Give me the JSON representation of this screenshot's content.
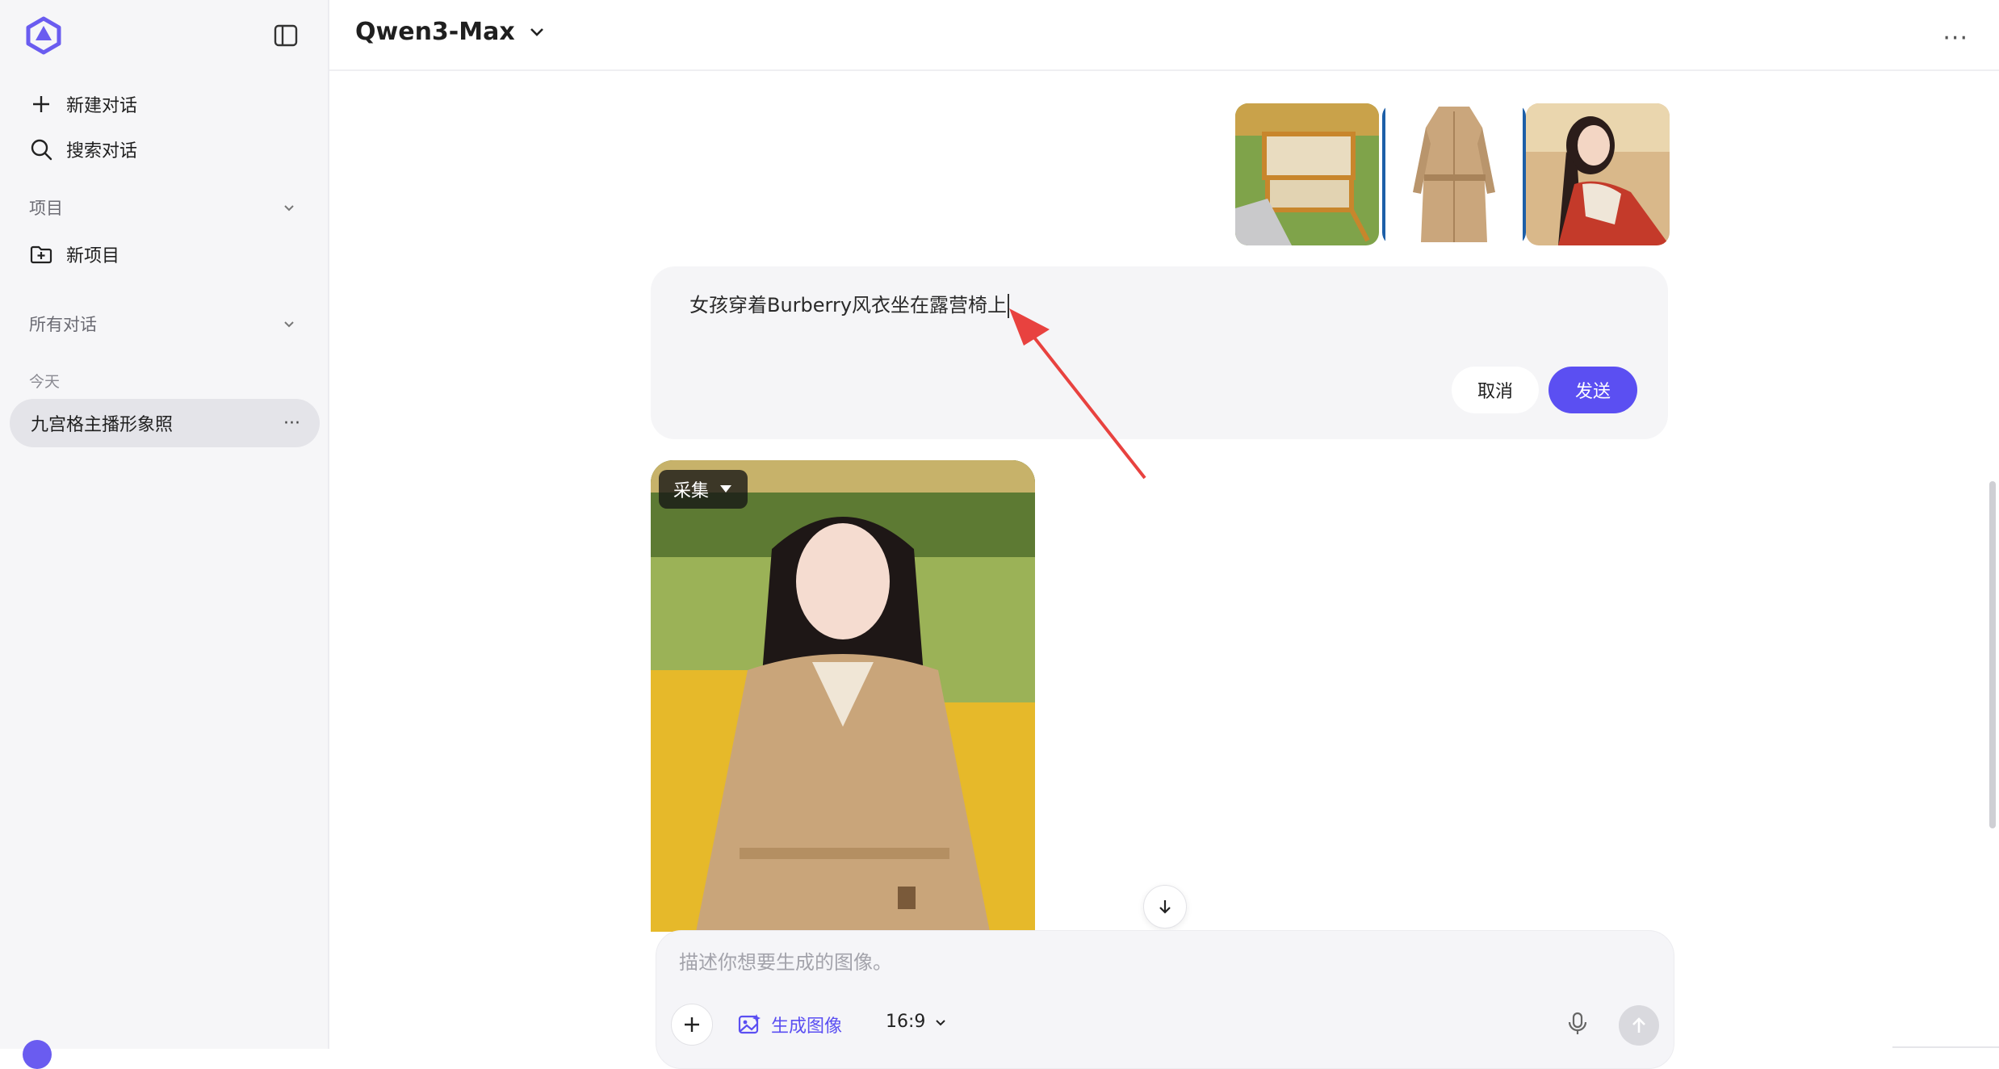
{
  "sidebar": {
    "new_chat": "新建对话",
    "search_chat": "搜索对话",
    "projects_label": "项目",
    "new_project": "新项目",
    "all_chats_label": "所有对话",
    "today_label": "今天",
    "chat_items": [
      {
        "title": "九宫格主播形象照",
        "more": "···"
      }
    ]
  },
  "header": {
    "model_name": "Qwen3-Max",
    "more": "···"
  },
  "edit_message": {
    "text": "女孩穿着Burberry风衣坐在露营椅上",
    "cancel_label": "取消",
    "send_label": "发送"
  },
  "attachments": [
    {
      "name": "camping-chair-image"
    },
    {
      "name": "trench-coat-image"
    },
    {
      "name": "girl-portrait-image"
    }
  ],
  "generated": {
    "collect_label": "采集"
  },
  "prompt": {
    "placeholder": "描述你想要生成的图像。",
    "generate_image_label": "生成图像",
    "aspect_ratio": "16:9"
  },
  "colors": {
    "accent": "#5b4ff2",
    "sidebar_bg": "#f6f6f8",
    "selected_item": "#e4e4e9",
    "annotation_arrow": "#e8423f"
  }
}
